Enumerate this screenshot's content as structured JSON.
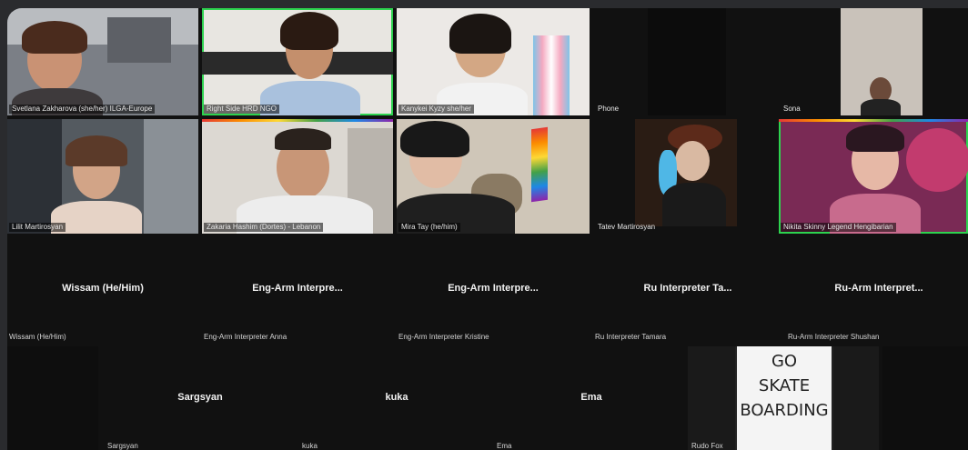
{
  "participants_top": [
    {
      "name": "Svetlana Zakharova (she/her) ILGA-Europe"
    },
    {
      "name": "Right Side HRD NGO"
    },
    {
      "name": "Kanykei Kyzy she/her"
    },
    {
      "name": "Phone"
    },
    {
      "name": "Sona"
    }
  ],
  "participants_mid": [
    {
      "name": "Lilit Martirosyan"
    },
    {
      "name": "Zakaria Hashim (Dortes) - Lebanon"
    },
    {
      "name": "Mira Tay (he/him)"
    },
    {
      "name": "Tatev Martirosyan"
    },
    {
      "name": "Nikita Skinny Legend Hengibarian"
    }
  ],
  "audio_only_row": [
    {
      "center_label": "Wissam (He/Him)",
      "name": "Wissam (He/Him)"
    },
    {
      "center_label": "Eng-Arm Interpre...",
      "name": "Eng-Arm Interpreter Anna"
    },
    {
      "center_label": "Eng-Arm Interpre...",
      "name": "Eng-Arm Interpreter Kristine"
    },
    {
      "center_label": "Ru Interpreter Ta...",
      "name": "Ru Interpreter Tamara"
    },
    {
      "center_label": "Ru-Arm Interpret...",
      "name": "Ru-Arm Interpreter Shushan"
    }
  ],
  "bottom_row": [
    {
      "center_label": "Sargsyan",
      "name": "Sargsyan"
    },
    {
      "center_label": "kuka",
      "name": "kuka"
    },
    {
      "center_label": "Ema",
      "name": "Ema"
    },
    {
      "center_label": "",
      "name": "Rudo Fox"
    }
  ],
  "sign_text": [
    "GO",
    "SKATE",
    "BOARDING"
  ],
  "colors": {
    "background": "#2a2b2e",
    "grid": "#111111",
    "active_speaker": "#2dd34f"
  }
}
